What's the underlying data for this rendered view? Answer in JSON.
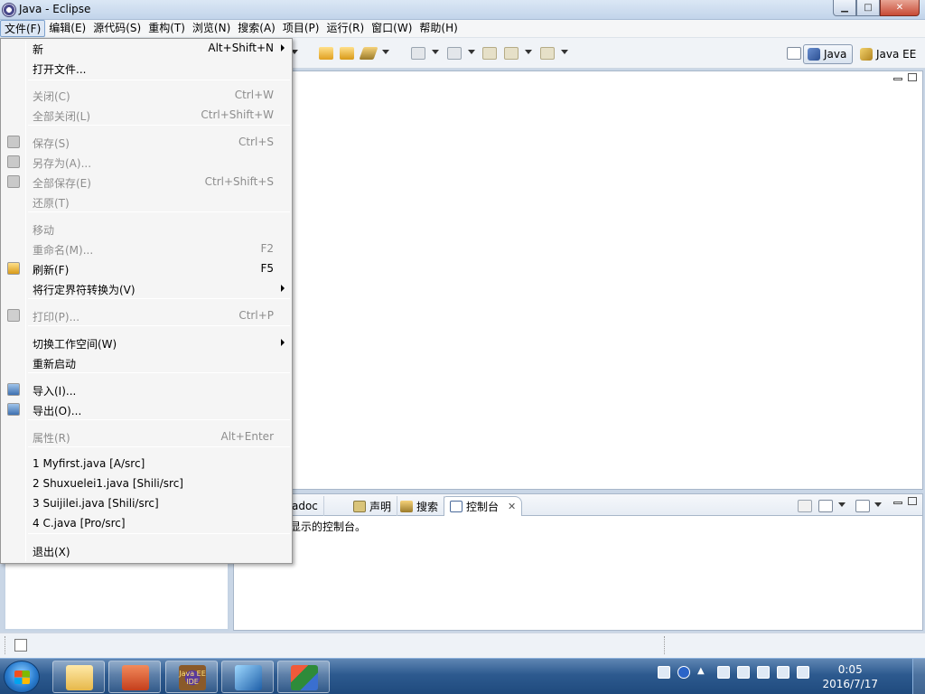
{
  "window": {
    "title": "Java  -  Eclipse",
    "minimize": "▁",
    "maximize": "□",
    "close": "✕"
  },
  "menubar": [
    "文件(F)",
    "编辑(E)",
    "源代码(S)",
    "重构(T)",
    "浏览(N)",
    "搜索(A)",
    "项目(P)",
    "运行(R)",
    "窗口(W)",
    "帮助(H)"
  ],
  "perspectives": {
    "java": "Java",
    "javaee": "Java EE"
  },
  "bottom_tabs": [
    "Javadoc",
    "声明",
    "搜索",
    "控制台"
  ],
  "console_text": "显示的控制台。",
  "file_menu": {
    "items": [
      {
        "label": "新",
        "shortcut": "Alt+Shift+N",
        "sub": true,
        "disabled": false,
        "icon": ""
      },
      {
        "label": "打开文件...",
        "shortcut": "",
        "sub": false,
        "disabled": false,
        "icon": ""
      },
      {
        "label": "关闭(C)",
        "shortcut": "Ctrl+W",
        "sub": false,
        "disabled": true,
        "icon": ""
      },
      {
        "label": "全部关闭(L)",
        "shortcut": "Ctrl+Shift+W",
        "sub": false,
        "disabled": true,
        "icon": ""
      },
      {
        "label": "保存(S)",
        "shortcut": "Ctrl+S",
        "sub": false,
        "disabled": true,
        "icon": "save-icon"
      },
      {
        "label": "另存为(A)...",
        "shortcut": "",
        "sub": false,
        "disabled": true,
        "icon": "save-as-icon"
      },
      {
        "label": "全部保存(E)",
        "shortcut": "Ctrl+Shift+S",
        "sub": false,
        "disabled": true,
        "icon": "save-all-icon"
      },
      {
        "label": "还原(T)",
        "shortcut": "",
        "sub": false,
        "disabled": true,
        "icon": ""
      },
      {
        "label": "移动",
        "shortcut": "",
        "sub": false,
        "disabled": true,
        "icon": ""
      },
      {
        "label": "重命名(M)...",
        "shortcut": "F2",
        "sub": false,
        "disabled": true,
        "icon": ""
      },
      {
        "label": "刷新(F)",
        "shortcut": "F5",
        "sub": false,
        "disabled": false,
        "icon": "refresh-icon"
      },
      {
        "label": "将行定界符转换为(V)",
        "shortcut": "",
        "sub": true,
        "disabled": false,
        "icon": ""
      },
      {
        "label": "打印(P)...",
        "shortcut": "Ctrl+P",
        "sub": false,
        "disabled": true,
        "icon": "print-icon"
      },
      {
        "label": "切换工作空间(W)",
        "shortcut": "",
        "sub": true,
        "disabled": false,
        "icon": ""
      },
      {
        "label": "重新启动",
        "shortcut": "",
        "sub": false,
        "disabled": false,
        "icon": ""
      },
      {
        "label": "导入(I)...",
        "shortcut": "",
        "sub": false,
        "disabled": false,
        "icon": "import-icon"
      },
      {
        "label": "导出(O)...",
        "shortcut": "",
        "sub": false,
        "disabled": false,
        "icon": "export-icon"
      },
      {
        "label": "属性(R)",
        "shortcut": "Alt+Enter",
        "sub": false,
        "disabled": true,
        "icon": ""
      },
      {
        "label": "1 Myfirst.java  [A/src]",
        "shortcut": "",
        "sub": false,
        "disabled": false,
        "icon": ""
      },
      {
        "label": "2 Shuxuelei1.java  [Shili/src]",
        "shortcut": "",
        "sub": false,
        "disabled": false,
        "icon": ""
      },
      {
        "label": "3 Suijilei.java  [Shili/src]",
        "shortcut": "",
        "sub": false,
        "disabled": false,
        "icon": ""
      },
      {
        "label": "4 C.java  [Pro/src]",
        "shortcut": "",
        "sub": false,
        "disabled": false,
        "icon": ""
      },
      {
        "label": "退出(X)",
        "shortcut": "",
        "sub": false,
        "disabled": false,
        "icon": ""
      }
    ]
  },
  "taskbar": {
    "apps": [
      "file-explorer-icon",
      "powerpoint-icon",
      "java-ee-ide-icon",
      "feather-icon",
      "office-icon"
    ],
    "javaee_badge": "Java EE IDE",
    "time": "0:05",
    "date": "2016/7/17"
  }
}
